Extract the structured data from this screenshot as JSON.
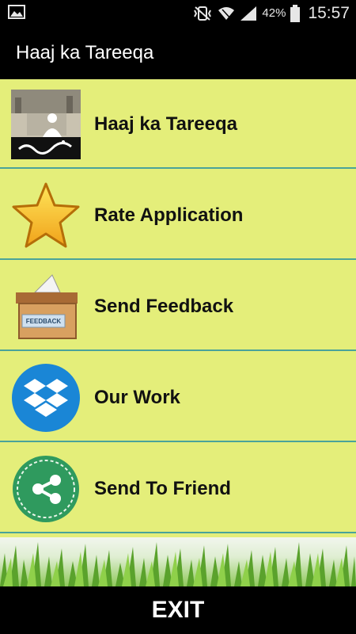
{
  "status_bar": {
    "battery_percent": "42%",
    "time": "15:57",
    "icons": [
      "image-icon",
      "mute-vibrate-icon",
      "wifi-icon",
      "signal-icon",
      "battery-icon"
    ]
  },
  "action_bar": {
    "title": "Haaj ka Tareeqa"
  },
  "menu": {
    "items": [
      {
        "label": "Haaj ka Tareeqa",
        "icon": "hajj-image-icon"
      },
      {
        "label": "Rate Application",
        "icon": "star-icon"
      },
      {
        "label": "Send Feedback",
        "icon": "feedback-box-icon"
      },
      {
        "label": "Our Work",
        "icon": "dropbox-icon"
      },
      {
        "label": "Send To Friend",
        "icon": "share-icon"
      }
    ]
  },
  "footer": {
    "exit_label": "EXIT"
  },
  "colors": {
    "list_bg": "#e4ee7a",
    "divider": "#4aa39a"
  }
}
